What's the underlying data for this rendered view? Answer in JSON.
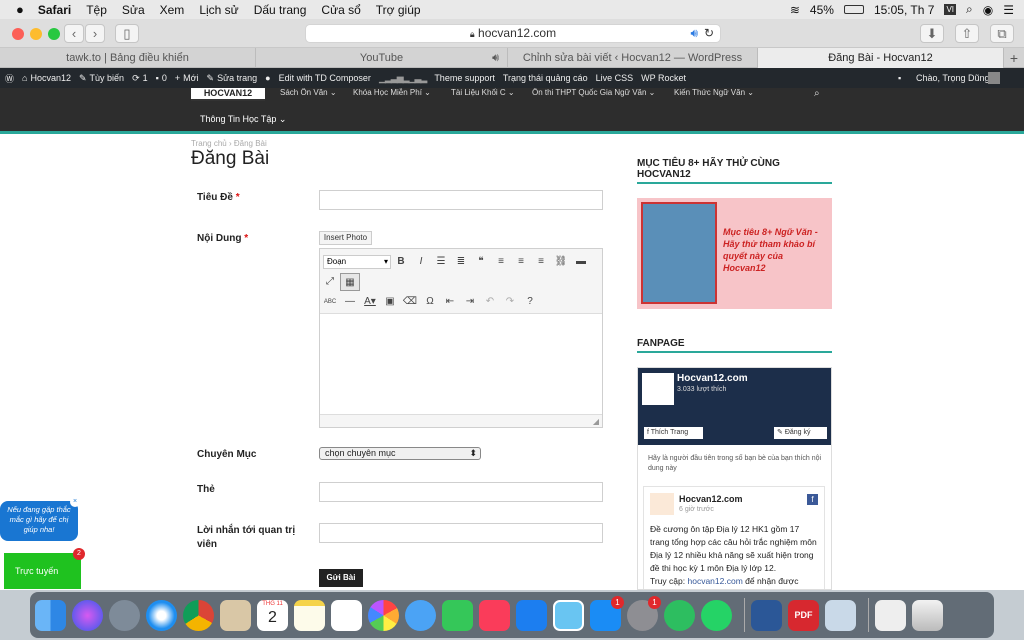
{
  "menubar": {
    "apple": "",
    "items": [
      "Safari",
      "Tệp",
      "Sửa",
      "Xem",
      "Lịch sử",
      "Dấu trang",
      "Cửa sổ",
      "Trợ giúp"
    ],
    "battery": "45%",
    "clock": "15:05, Th 7"
  },
  "browser": {
    "url": "hocvan12.com",
    "tabs": [
      "tawk.to | Bảng điều khiển",
      "YouTube",
      "Chỉnh sửa bài viết ‹ Hocvan12 — WordPress",
      "Đăng Bài - Hocvan12"
    ],
    "new_tab": "+"
  },
  "wpadmin": {
    "site": "Hocvan12",
    "customize": "Tùy biến",
    "updates": "1",
    "comments": "0",
    "new": "Mới",
    "edit": "Sửa trang",
    "composer": "Edit with TD Composer",
    "theme_support": "Theme support",
    "ads": "Trạng thái quảng cáo",
    "live_css": "Live CSS",
    "wp_rocket": "WP Rocket",
    "greeting": "Chào, Trọng Dũng"
  },
  "site": {
    "logo": "HOCVAN12",
    "nav": [
      "Sách Ôn Văn",
      "Khóa Học Miễn Phí",
      "Tài Liệu Khối C",
      "Ôn thi THPT Quốc Gia Ngữ Văn",
      "Kiến Thức Ngữ Văn"
    ],
    "subnav": "Thông Tin Học Tập"
  },
  "breadcrumb": {
    "home": "Trang chủ",
    "sep": "›",
    "current": "Đăng Bài"
  },
  "form": {
    "title": "Đăng Bài",
    "f_title": "Tiêu Đề",
    "f_content": "Nội Dung",
    "f_category": "Chuyên Mục",
    "f_tags": "Thẻ",
    "f_note": "Lời nhắn tới quan trị viên",
    "req": "*",
    "insert_photo": "Insert Photo",
    "format": "Đoạn",
    "category_value": "chọn chuyên mục",
    "submit": "Gửi Bài"
  },
  "sidebar": {
    "promo_title": "MỤC TIÊU 8+ HÃY THỬ CÙNG HOCVAN12",
    "promo_text": "Mục tiêu 8+ Ngữ Văn - Hãy thử tham khảo bí quyết này của Hocvan12",
    "fanpage_title": "FANPAGE",
    "fb_name": "Hocvan12.com",
    "fb_likes": "3.033 lượt thích",
    "fb_like_btn": "Thích Trang",
    "fb_register": "Đăng ký",
    "fb_first": "Hãy là người đầu tiên trong số bạn bè của bạn thích nội dung này",
    "post_name": "Hocvan12.com",
    "post_time": "6 giờ trước",
    "post_body": "Đề cương ôn tập Địa lý 12 HK1 gồm 17 trang tổng hợp các câu hỏi trắc nghiệm môn Địa lý 12 nhiều khả năng sẽ xuất hiện trong đề thi học kỳ 1 môn Địa lý lớp 12.",
    "post_link_prefix": "Truy cập:",
    "post_link": "hocvan12.com",
    "post_link_suffix": "để nhận được"
  },
  "chat": {
    "bubble": "Nếu đang gặp thắc mắc gì hãy để chị giúp nha!",
    "online": "Trực tuyến",
    "badge": "2"
  },
  "dock": {
    "calendar_month": "THG 11",
    "calendar_day": "2",
    "badge_appstore": "1",
    "badge_prefs": "1"
  }
}
